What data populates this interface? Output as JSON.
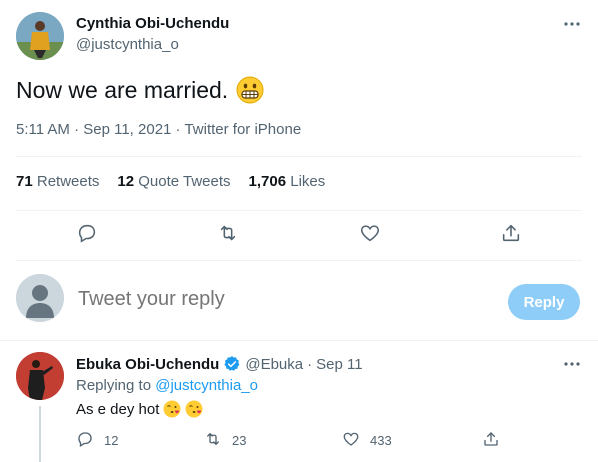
{
  "tweet": {
    "author_name": "Cynthia Obi-Uchendu",
    "author_handle": "@justcynthia_o",
    "text": "Now we are married.",
    "emoji": "grimacing-face",
    "meta": "5:11 AM · Sep 11, 2021 · Twitter for iPhone",
    "stats": {
      "retweets_count": "71",
      "retweets_label": "Retweets",
      "quotes_count": "12",
      "quotes_label": "Quote Tweets",
      "likes_count": "1,706",
      "likes_label": "Likes"
    },
    "actions": [
      "reply-icon",
      "retweet-icon",
      "like-icon",
      "share-icon"
    ]
  },
  "composer": {
    "placeholder": "Tweet your reply",
    "button_label": "Reply"
  },
  "reply": {
    "author_name": "Ebuka Obi-Uchendu",
    "author_handle": "@Ebuka",
    "separator": "·",
    "date": "Sep 11",
    "replying_prefix": "Replying to",
    "replying_mention": "@justcynthia_o",
    "text": "As e dey hot",
    "emojis": [
      "face-blowing-a-kiss",
      "face-blowing-a-kiss"
    ],
    "reply_count": "12",
    "retweet_count": "23",
    "like_count": "433"
  },
  "colors": {
    "accent": "#1d9bf0",
    "reply_button": "#8ecdf8",
    "muted_text": "#536471",
    "divider": "#eff3f4"
  }
}
